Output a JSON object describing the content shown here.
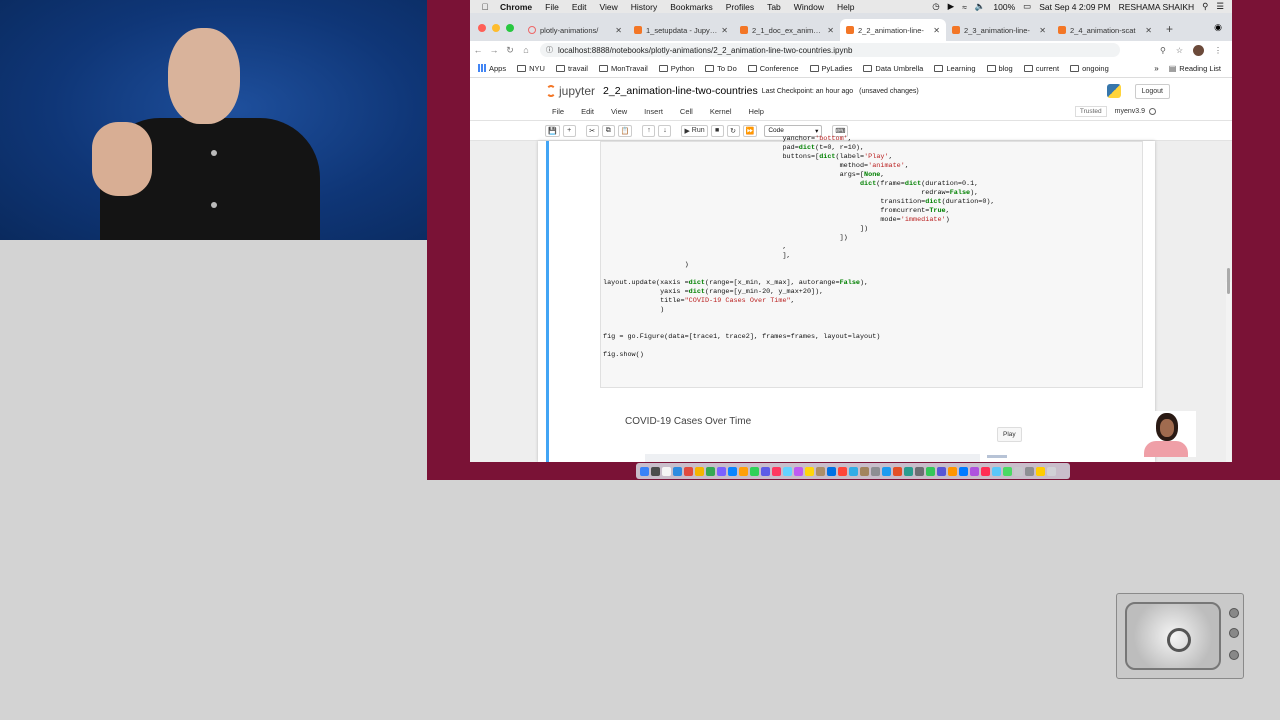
{
  "menubar": {
    "app": "Chrome",
    "items": [
      "File",
      "Edit",
      "View",
      "History",
      "Bookmarks",
      "Profiles",
      "Tab",
      "Window",
      "Help"
    ],
    "battery": "100%",
    "datetime": "Sat Sep 4  2:09 PM",
    "user": "RESHAMA SHAIKH"
  },
  "tabs": [
    {
      "label": "plotly-animations/",
      "active": false
    },
    {
      "label": "1_setupdata - Jupyter",
      "active": false
    },
    {
      "label": "2_1_doc_ex_animation",
      "active": false
    },
    {
      "label": "2_2_animation-line-",
      "active": true
    },
    {
      "label": "2_3_animation-line-",
      "active": false
    },
    {
      "label": "2_4_animation-scat",
      "active": false
    }
  ],
  "address": {
    "url": "localhost:8888/notebooks/plotly-animations/2_2_animation-line-two-countries.ipynb"
  },
  "bookmarks": {
    "items": [
      "Apps",
      "NYU",
      "travail",
      "MonTravail",
      "Python",
      "To Do",
      "Conference",
      "PyLadies",
      "Data Umbrella",
      "Learning",
      "blog",
      "current",
      "ongoing"
    ],
    "more": "»",
    "reading_list": "Reading List"
  },
  "jupyter": {
    "logo_text": "jupyter",
    "notebook_title": "2_2_animation-line-two-countries",
    "checkpoint": "Last Checkpoint: an hour ago",
    "unsaved": "(unsaved changes)",
    "logout": "Logout",
    "menu": [
      "File",
      "Edit",
      "View",
      "Insert",
      "Cell",
      "Kernel",
      "Help"
    ],
    "trusted": "Trusted",
    "kernel": "myenv3.9",
    "toolbar": {
      "run_label": "Run",
      "cell_type": "Code"
    }
  },
  "code_lines": [
    "                                            yanchor='bottom',",
    "                                            pad=dict(t=0, r=10),",
    "                                            buttons=[dict(label='Play',",
    "                                                          method='animate',",
    "                                                          args=[None,",
    "                                                               dict(frame=dict(duration=0.1,",
    "                                                                              redraw=False),",
    "                                                                    transition=dict(duration=0),",
    "                                                                    fromcurrent=True,",
    "                                                                    mode='immediate')",
    "                                                               ])",
    "                                                          ])",
    "                                            ,",
    "                                            ],",
    "                    )",
    "",
    "layout.update(xaxis =dict(range=[x_min, x_max], autorange=False),",
    "              yaxis =dict(range=[y_min-20, y_max+20]),",
    "              title=\"COVID-19 Cases Over Time\",",
    "              )",
    "",
    "",
    "fig = go.Figure(data=[trace1, trace2], frames=frames, layout=layout)",
    "",
    "fig.show()"
  ],
  "output": {
    "plot_title": "COVID-19 Cases Over Time",
    "play_button": "Play"
  },
  "colors": {
    "frame_bg": "#7a1236",
    "interpreter_bg": "#0f3677",
    "cell_select": "#42a5f5",
    "jupyter_orange": "#f37626"
  }
}
